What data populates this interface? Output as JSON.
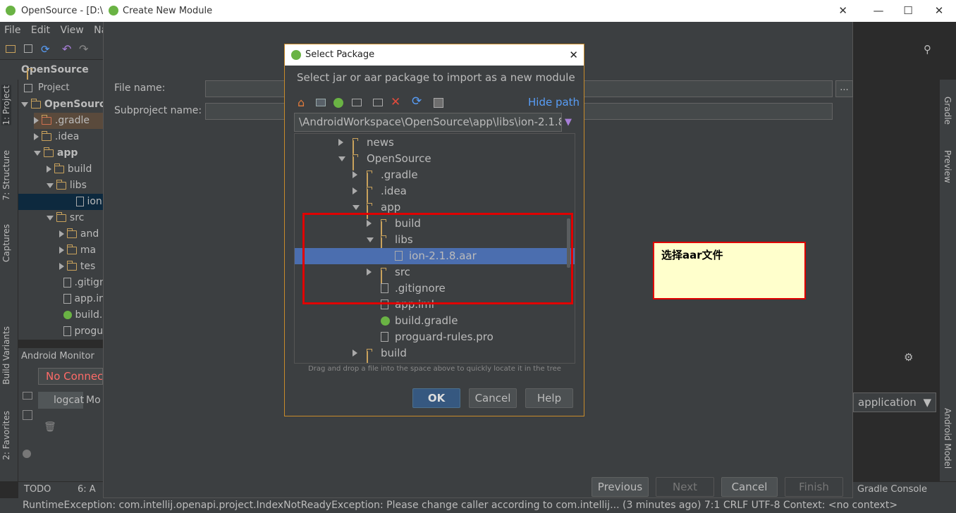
{
  "ide": {
    "title": "OpenSource - [D:\\d",
    "menu": [
      "File",
      "Edit",
      "View",
      "Na"
    ],
    "nav_project": "OpenSource",
    "project_tab": "Project",
    "tree": [
      {
        "label": "OpenSource",
        "bold": true
      },
      {
        "label": ".gradle"
      },
      {
        "label": ".idea"
      },
      {
        "label": "app",
        "bold": true
      },
      {
        "label": "build"
      },
      {
        "label": "libs"
      },
      {
        "label": "ion"
      },
      {
        "label": "src"
      },
      {
        "label": "and"
      },
      {
        "label": "ma"
      },
      {
        "label": "tes"
      },
      {
        "label": ".gitign"
      },
      {
        "label": "app.in"
      },
      {
        "label": "build.g"
      },
      {
        "label": "progu"
      }
    ],
    "left_tabs": [
      "1: Project",
      "7: Structure",
      "Captures",
      "Build Variants",
      "2: Favorites"
    ],
    "right_tabs": [
      "Gradle",
      "Preview",
      "Android Model"
    ],
    "android_monitor": "Android Monitor",
    "no_connect": "No Connect",
    "logcat": "logcat",
    "monitor_tab2": "Mo",
    "bottom_tabs": {
      "todo": "TODO",
      "android": "6: A",
      "gradle_console": "Gradle Console"
    },
    "status": "RuntimeException: com.intellij.openapi.project.IndexNotReadyException: Please change caller according to com.intellij... (3 minutes ago)    7:1   CRLF   UTF-8   Context: <no context>",
    "run_config": "application"
  },
  "create_module": {
    "title": "Create New Module",
    "file_name_label": "File name:",
    "subproject_label": "Subproject name:",
    "browse": "...",
    "buttons": {
      "previous": "Previous",
      "next": "Next",
      "cancel": "Cancel",
      "finish": "Finish"
    }
  },
  "select_package": {
    "title": "Select Package",
    "description": "Select jar or aar package to import as a new module",
    "hide_path": "Hide path",
    "path": "\\AndroidWorkspace\\OpenSource\\app\\libs\\ion-2.1.8.aar",
    "tree": [
      {
        "label": "news",
        "type": "folder",
        "indent": 0,
        "arrow": "right"
      },
      {
        "label": "OpenSource",
        "type": "folder",
        "indent": 0,
        "arrow": "down"
      },
      {
        "label": ".gradle",
        "type": "folder",
        "indent": 1,
        "arrow": "right"
      },
      {
        "label": ".idea",
        "type": "folder",
        "indent": 1,
        "arrow": "right"
      },
      {
        "label": "app",
        "type": "folder",
        "indent": 1,
        "arrow": "down"
      },
      {
        "label": "build",
        "type": "folder",
        "indent": 2,
        "arrow": "right"
      },
      {
        "label": "libs",
        "type": "folder",
        "indent": 2,
        "arrow": "down"
      },
      {
        "label": "ion-2.1.8.aar",
        "type": "file",
        "indent": 3,
        "arrow": "none",
        "selected": true
      },
      {
        "label": "src",
        "type": "folder",
        "indent": 2,
        "arrow": "right"
      },
      {
        "label": ".gitignore",
        "type": "file",
        "indent": 2,
        "arrow": "none"
      },
      {
        "label": "app.iml",
        "type": "file",
        "indent": 2,
        "arrow": "none"
      },
      {
        "label": "build.gradle",
        "type": "gradle",
        "indent": 2,
        "arrow": "none"
      },
      {
        "label": "proguard-rules.pro",
        "type": "file",
        "indent": 2,
        "arrow": "none"
      },
      {
        "label": "build",
        "type": "folder",
        "indent": 1,
        "arrow": "right"
      }
    ],
    "hint": "Drag and drop a file into the space above to quickly locate it in the tree",
    "buttons": {
      "ok": "OK",
      "cancel": "Cancel",
      "help": "Help"
    }
  },
  "annotation": {
    "note": "选择aar文件"
  },
  "colors": {
    "accent": "#589df6",
    "selection": "#4b6eaf",
    "highlight": "#e00000",
    "note_bg": "#ffffcc"
  }
}
